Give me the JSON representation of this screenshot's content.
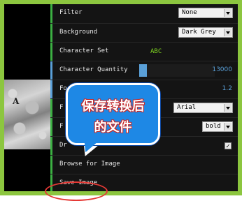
{
  "colors": {
    "frame": "#8cc63f",
    "accent_green": "#3cb043",
    "accent_blue": "#5aa0d8",
    "callout": "#1e88e5",
    "highlight_circle": "#e53935"
  },
  "preview": {
    "char": "A"
  },
  "rows": {
    "filter": {
      "label": "Filter",
      "value": "None"
    },
    "background": {
      "label": "Background",
      "value": "Dark Grey"
    },
    "character_set": {
      "label": "Character Set",
      "value": "ABC"
    },
    "character_quantity": {
      "label": "Character Quantity",
      "value": "13000",
      "fill_fraction": 0.1
    },
    "font_size": {
      "label": "Fo",
      "value": "1.2"
    },
    "font": {
      "label": "F",
      "value": "Arial"
    },
    "font_weight": {
      "label": "F",
      "value": "bold"
    },
    "draw": {
      "label": "Dr",
      "checked": true,
      "check_glyph": "✓"
    },
    "browse": {
      "label": "Browse for Image"
    },
    "save": {
      "label": "Save Image"
    }
  },
  "callout": {
    "line1": "保存转换后",
    "line2": "的文件"
  }
}
